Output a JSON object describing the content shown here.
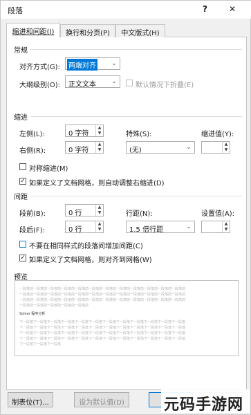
{
  "window": {
    "title": "段落",
    "help_label": "?",
    "close_label": "✕"
  },
  "tabs": [
    {
      "label": "缩进和间距(I)",
      "active": true
    },
    {
      "label": "换行和分页(P)",
      "active": false
    },
    {
      "label": "中文版式(H)",
      "active": false
    }
  ],
  "general": {
    "section_label": "常规",
    "alignment_label": "对齐方式(G):",
    "alignment_value": "两端对齐",
    "outline_label": "大纲级别(O):",
    "outline_value": "正文文本",
    "collapsed_label": "默认情况下折叠(E)"
  },
  "indent": {
    "section_label": "缩进",
    "left_label": "左侧(L):",
    "left_value": "0 字符",
    "right_label": "右侧(R):",
    "right_value": "0 字符",
    "special_label": "特殊(S):",
    "special_value": "(无)",
    "indent_by_label": "缩进值(Y):",
    "indent_by_value": "",
    "mirror_label": "对称缩进(M)",
    "auto_adjust_label": "如果定义了文档网格，则自动调整右缩进(D)"
  },
  "spacing": {
    "section_label": "间距",
    "before_label": "段前(B):",
    "before_value": "0 行",
    "after_label": "段后(F):",
    "after_value": "0 行",
    "line_spacing_label": "行距(N):",
    "line_spacing_value": "1.5 倍行距",
    "at_label": "设置值(A):",
    "at_value": "",
    "no_space_label": "不要在相同样式的段落间增加间距(C)",
    "snap_grid_label": "如果定义了文档网格，则对齐到网格(W)"
  },
  "preview": {
    "section_label": "预览",
    "prev_line": "一段落前一段落前一段落前一段落前一段落前一段落前一段落前一段落前一段落前一段落前一段落前一段落前",
    "prev_tail": "一段落前一段落前一段落前一段落前一段落前",
    "sample_text": "Solver 程序分析",
    "next_line": "下一段落下一段落下一段落下一段落下一段落下一段落下一段落下一段落下一段落下一段落下一段落下一段落",
    "next_tail": "下一段落下一段落下一段落"
  },
  "footer": {
    "tabs_button": "制表位(T)...",
    "default_button": "设为默认值(D)",
    "ok_button": "确定",
    "cancel_button": "取消"
  },
  "watermark": "元码手游网",
  "colors": {
    "selection": "#0078d7",
    "accent_focus": "#0078d7"
  }
}
